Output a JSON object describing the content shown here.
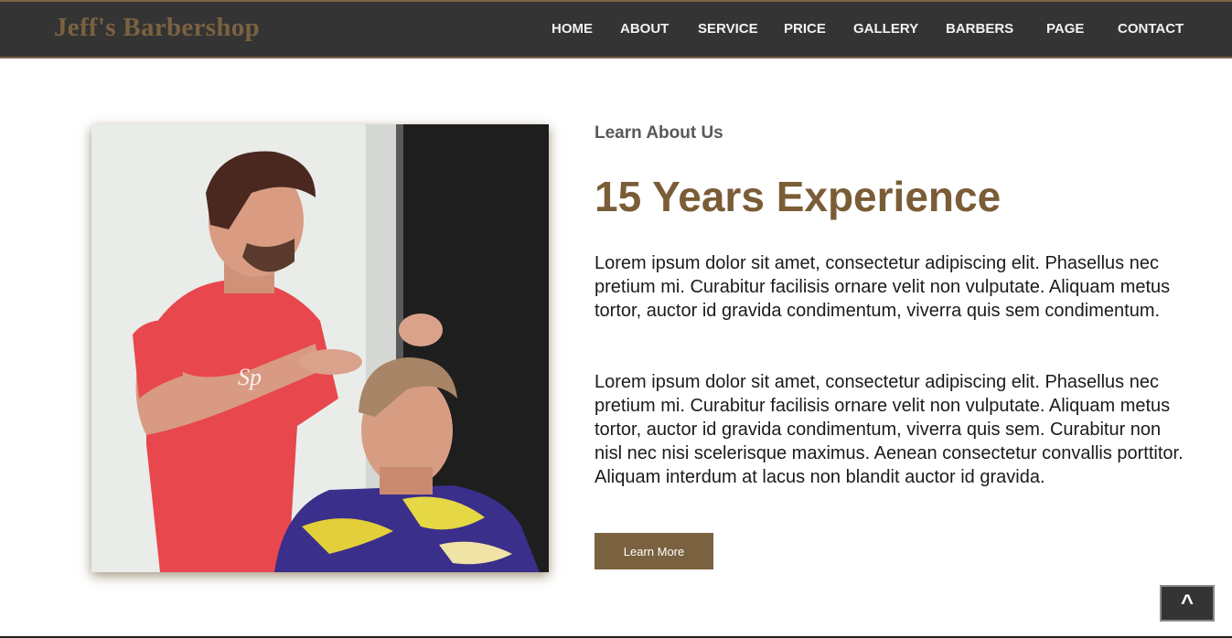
{
  "brand": {
    "name": "Jeff's Barbershop"
  },
  "nav": {
    "home": "HOME",
    "about": "ABOUT",
    "service": "SERVICE",
    "price": "PRICE",
    "gallery": "GALLERY",
    "barbers": "BARBERS",
    "page": "PAGE",
    "contact": "CONTACT"
  },
  "about": {
    "eyebrow": "Learn About Us",
    "headline": "15 Years Experience",
    "paragraph_1": "Lorem ipsum dolor sit amet, consectetur adipiscing elit. Phasellus nec pretium mi. Curabitur facilisis ornare velit non vulputate. Aliquam metus tortor, auctor id gravida condimentum, viverra quis sem condimentum.",
    "paragraph_2": "Lorem ipsum dolor sit amet, consectetur adipiscing elit. Phasellus nec pretium mi. Curabitur facilisis ornare velit non vulputate. Aliquam metus tortor, auctor id gravida condimentum, viverra quis sem. Curabitur non nisl nec nisi scelerisque maximus. Aenean consectetur convallis porttitor. Aliquam interdum at lacus non blandit auctor id gravida.",
    "button_label": "Learn More",
    "photo_icon": "barber-photo-image"
  },
  "back_to_top": {
    "label": "^",
    "icon": "chevron-up-icon"
  },
  "colors": {
    "nav_background": "#343434",
    "brand": "#7a6240",
    "accent": "#7a5c36",
    "button": "#7a6240"
  }
}
